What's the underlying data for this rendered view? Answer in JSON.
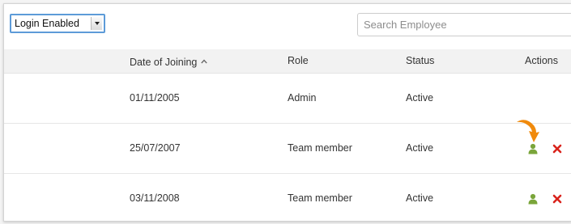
{
  "filter": {
    "selected": "Login Enabled"
  },
  "search": {
    "placeholder": "Search Employee"
  },
  "table": {
    "headers": {
      "date_of_joining": "Date of Joining",
      "role": "Role",
      "status": "Status",
      "actions": "Actions"
    },
    "rows": [
      {
        "date": "01/11/2005",
        "role": "Admin",
        "status": "Active",
        "actions": []
      },
      {
        "date": "25/07/2007",
        "role": "Team member",
        "status": "Active",
        "actions": [
          "user-icon",
          "delete-icon"
        ]
      },
      {
        "date": "03/11/2008",
        "role": "Team member",
        "status": "Active",
        "actions": [
          "user-icon",
          "delete-icon"
        ]
      }
    ]
  },
  "colors": {
    "user_icon": "#7aa53a",
    "delete_icon": "#d9231c",
    "pointer_arrow": "#f08a0c"
  },
  "icons": {
    "sort": "sort-icon",
    "user": "user-icon",
    "delete": "delete-icon",
    "pointer": "pointer-arrow-icon"
  }
}
